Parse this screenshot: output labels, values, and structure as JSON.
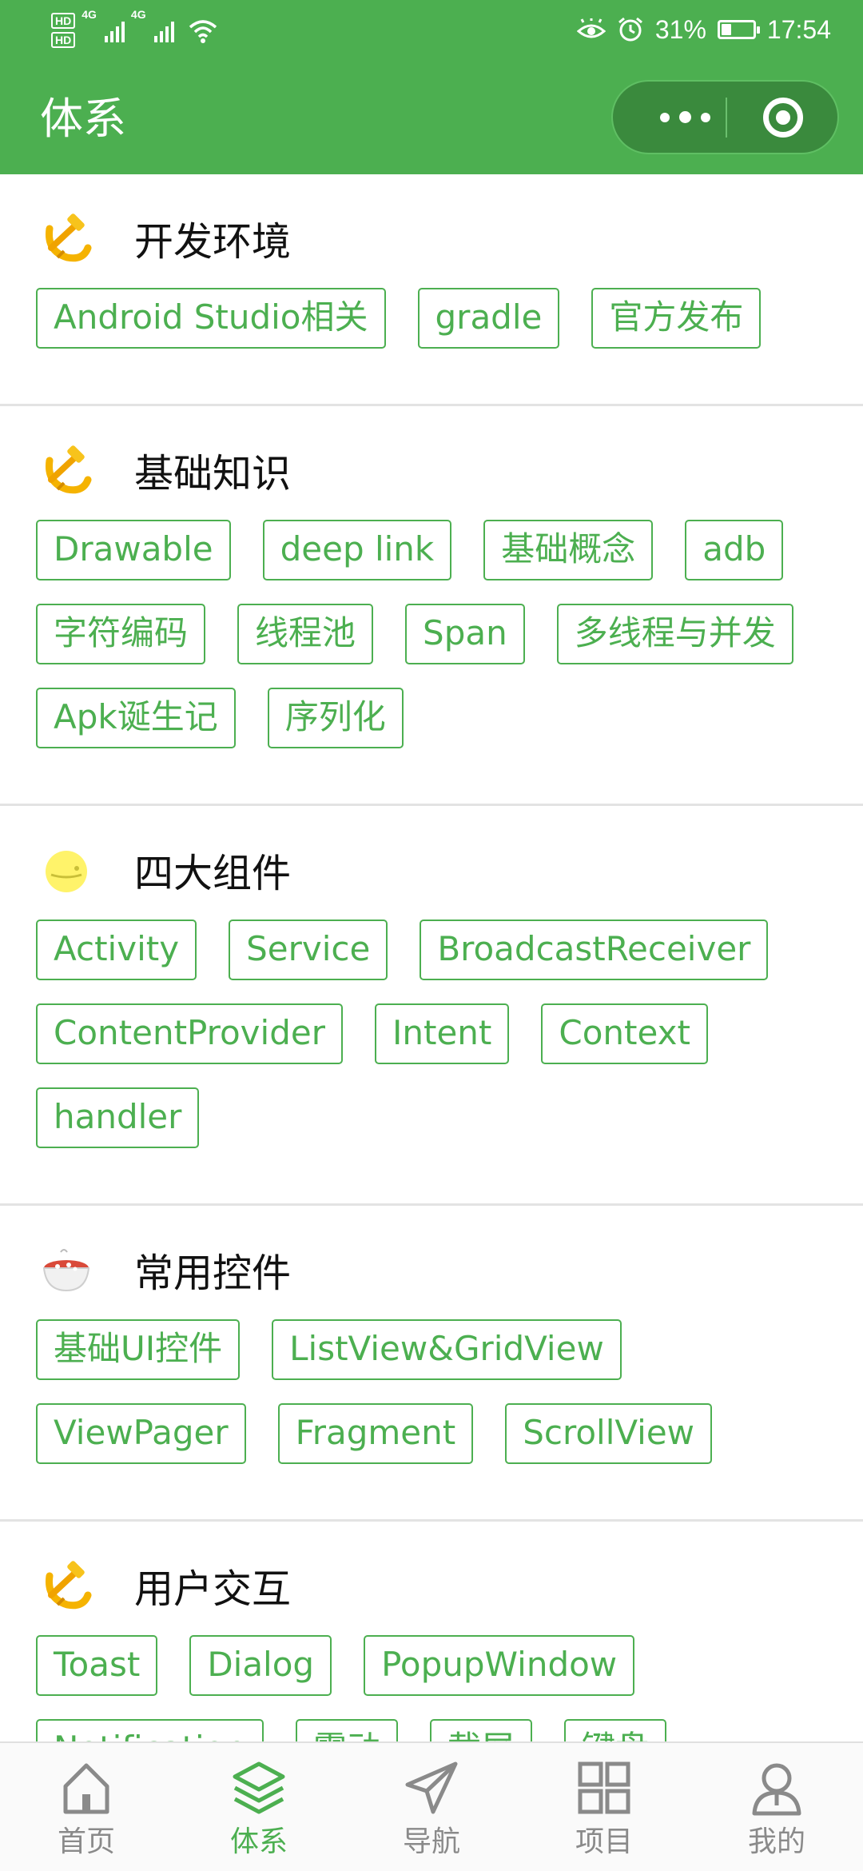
{
  "status_bar": {
    "left_indicators": [
      "HD",
      "HD",
      "4G",
      "4G"
    ],
    "battery_percent": "31%",
    "battery_level": 0.31,
    "time": "17:54",
    "icons": [
      "signal-icon",
      "wifi-icon",
      "eye-icon",
      "alarm-icon",
      "battery-icon"
    ]
  },
  "header": {
    "title": "体系",
    "capsule": {
      "more_icon": "more-dots-icon",
      "close_icon": "target-circle-icon"
    }
  },
  "colors": {
    "accent": "#4caf50",
    "capsule": "#3a8a3d",
    "divider": "#e3e3e3",
    "inactive": "#8a8a8a"
  },
  "sections": [
    {
      "title": "开发环境",
      "icon": "hammer-sickle-icon",
      "tags": [
        "Android Studio相关",
        "gradle",
        "官方发布"
      ]
    },
    {
      "title": "基础知识",
      "icon": "hammer-sickle-icon",
      "tags": [
        "Drawable",
        "deep link",
        "基础概念",
        "adb",
        "字符编码",
        "线程池",
        "Span",
        "多线程与并发",
        "Apk诞生记",
        "序列化"
      ]
    },
    {
      "title": "四大组件",
      "icon": "moon-face-icon",
      "tags": [
        "Activity",
        "Service",
        "BroadcastReceiver",
        "ContentProvider",
        "Intent",
        "Context",
        "handler"
      ]
    },
    {
      "title": "常用控件",
      "icon": "noodle-bowl-icon",
      "tags": [
        "基础UI控件",
        "ListView&GridView",
        "ViewPager",
        "Fragment",
        "ScrollView"
      ]
    },
    {
      "title": "用户交互",
      "icon": "hammer-sickle-icon",
      "tags": [
        "Toast",
        "Dialog",
        "PopupWindow",
        "Notification",
        "震动",
        "截屏",
        "键盘"
      ]
    }
  ],
  "tabbar": {
    "items": [
      {
        "label": "首页",
        "icon": "home-icon",
        "active": false
      },
      {
        "label": "体系",
        "icon": "layers-icon",
        "active": true
      },
      {
        "label": "导航",
        "icon": "paper-plane-icon",
        "active": false
      },
      {
        "label": "项目",
        "icon": "grid-icon",
        "active": false
      },
      {
        "label": "我的",
        "icon": "user-icon",
        "active": false
      }
    ]
  }
}
